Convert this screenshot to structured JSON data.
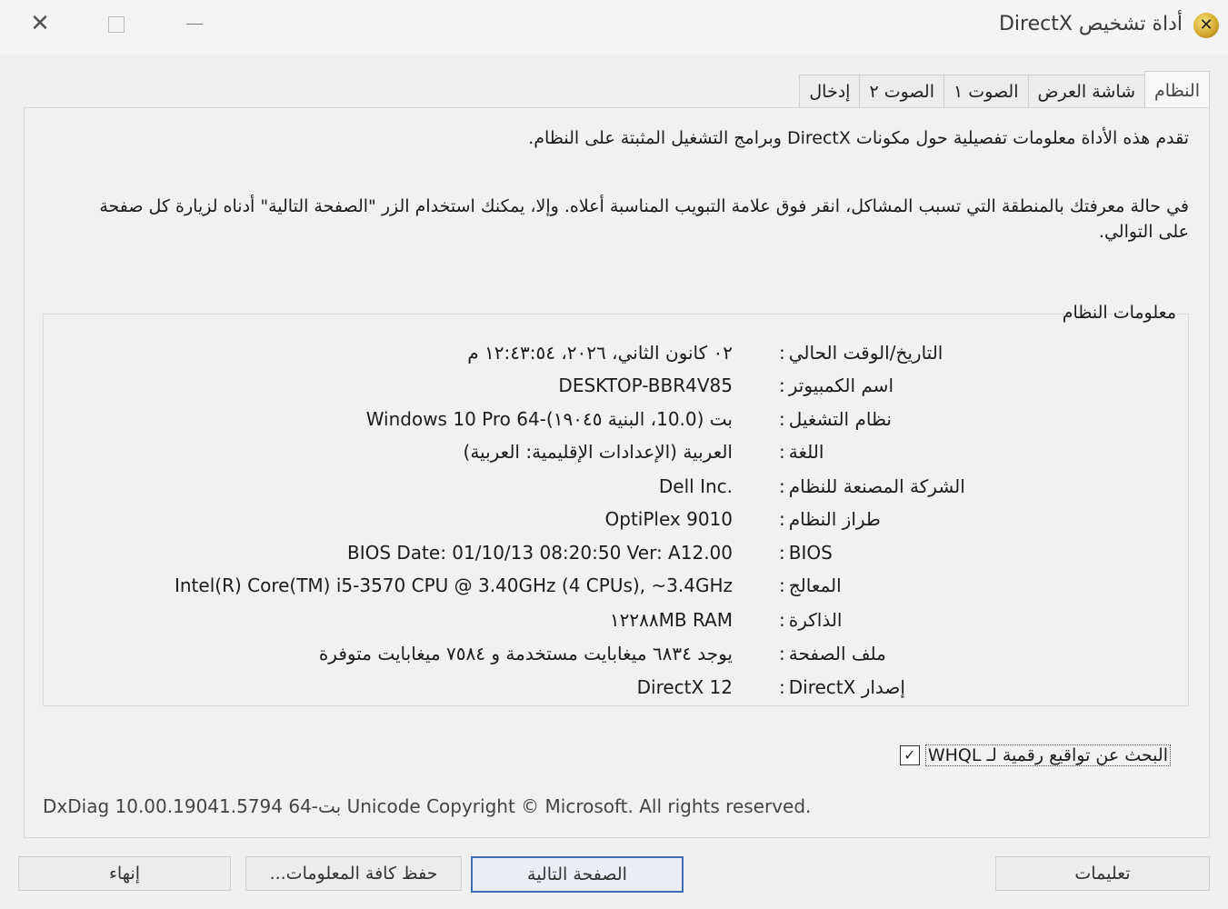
{
  "window": {
    "title": "أداة تشخيص DirectX",
    "close_glyph": "✕",
    "app_icon_glyph": "✕"
  },
  "tabs": [
    {
      "label": "النظام",
      "active": true
    },
    {
      "label": "شاشة العرض",
      "active": false
    },
    {
      "label": "الصوت ١",
      "active": false
    },
    {
      "label": "الصوت ٢",
      "active": false
    },
    {
      "label": "إدخال",
      "active": false
    }
  ],
  "intro": {
    "line1": "تقدم هذه الأداة معلومات تفصيلية حول مكونات DirectX وبرامج التشغيل المثبتة على النظام.",
    "line2": "في حالة معرفتك بالمنطقة التي تسبب المشاكل، انقر فوق علامة التبويب المناسبة أعلاه. وإلا، يمكنك استخدام الزر \"الصفحة التالية\" أدناه لزيارة كل صفحة على التوالي."
  },
  "system_info": {
    "section_label": "معلومات النظام",
    "rows": [
      {
        "label": "التاريخ/الوقت الحالي",
        "value": "٠٢ كانون الثاني، ٢٠٢٦، ١٢:٤٣:٥٤ م"
      },
      {
        "label": "اسم الكمبيوتر",
        "value": "DESKTOP-BBR4V85"
      },
      {
        "label": "نظام التشغيل",
        "value": "Windows 10 Pro 64-بت (10.0، البنية ١٩٠٤٥)"
      },
      {
        "label": "اللغة",
        "value": "العربية (الإعدادات الإقليمية: العربية)"
      },
      {
        "label": "الشركة المصنعة للنظام",
        "value": "Dell Inc."
      },
      {
        "label": "طراز النظام",
        "value": "OptiPlex 9010"
      },
      {
        "label": "BIOS",
        "value": "BIOS Date: 01/10/13 08:20:50 Ver: A12.00"
      },
      {
        "label": "المعالج",
        "value": "Intel(R) Core(TM) i5-3570 CPU @ 3.40GHz (4 CPUs), ~3.4GHz"
      },
      {
        "label": "الذاكرة",
        "value": "١٢٢٨٨MB RAM"
      },
      {
        "label": "ملف الصفحة",
        "value": "يوجد ٦٨٣٤ ميغابايت مستخدمة و ٧٥٨٤ ميغابايت متوفرة"
      },
      {
        "label": "إصدار DirectX",
        "value": "DirectX 12"
      }
    ]
  },
  "whql": {
    "label": "البحث عن تواقيع رقمية لـ WHQL",
    "checked": true,
    "check_glyph": "✓"
  },
  "version_line": "DxDiag 10.00.19041.5794 64-بت Unicode  Copyright © Microsoft. All rights reserved.",
  "buttons": {
    "help": "تعليمات",
    "next": "الصفحة التالية",
    "save": "حفظ كافة المعلومات...",
    "exit": "إنهاء"
  }
}
